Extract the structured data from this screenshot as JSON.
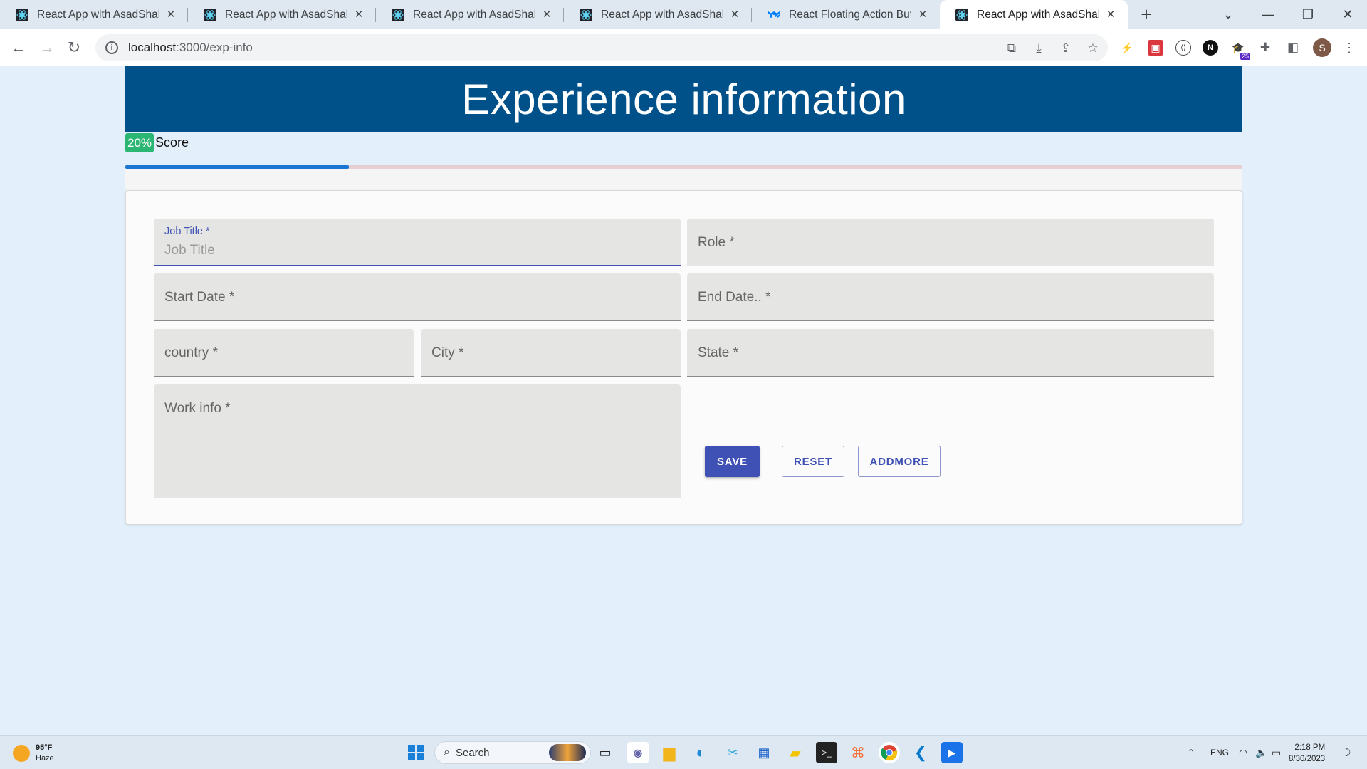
{
  "browser": {
    "tabs": [
      {
        "title": "React App with AsadShahi",
        "active": false,
        "favicon": "react-icon"
      },
      {
        "title": "React App with AsadShahi",
        "active": false,
        "favicon": "react-icon"
      },
      {
        "title": "React App with AsadShahi",
        "active": false,
        "favicon": "react-icon"
      },
      {
        "title": "React App with AsadShahi",
        "active": false,
        "favicon": "react-icon"
      },
      {
        "title": "React Floating Action Button",
        "active": false,
        "favicon": "mui-icon"
      },
      {
        "title": "React App with AsadShahi",
        "active": true,
        "favicon": "react-icon"
      }
    ],
    "url_host": "localhost",
    "url_path": ":3000/exp-info",
    "avatar_letter": "S",
    "extension_badge": "25"
  },
  "page": {
    "title": "Experience information",
    "score_badge": "20%",
    "score_label": "Score",
    "progress": 0.2
  },
  "form": {
    "job_title": {
      "label": "Job Title *",
      "placeholder": "Job Title"
    },
    "role": {
      "placeholder": "Role  *"
    },
    "start_date": {
      "placeholder": "Start Date *"
    },
    "end_date": {
      "placeholder": "End Date.. *"
    },
    "country": {
      "placeholder": "country *"
    },
    "city": {
      "placeholder": "City *"
    },
    "state": {
      "placeholder": "State *"
    },
    "work_info": {
      "placeholder": "Work info *"
    },
    "buttons": {
      "save": "SAVE",
      "reset": "RESET",
      "addmore": "ADDMORE"
    }
  },
  "taskbar": {
    "weather_temp": "95°F",
    "weather_desc": "Haze",
    "search_label": "Search",
    "lang": "ENG",
    "time": "2:18 PM",
    "date": "8/30/2023"
  },
  "colors": {
    "header": "#00508a",
    "primary": "#3f51b5",
    "score_badge": "#2bb673",
    "progress": "#1976d2",
    "page_bg": "#e3f0fb"
  }
}
